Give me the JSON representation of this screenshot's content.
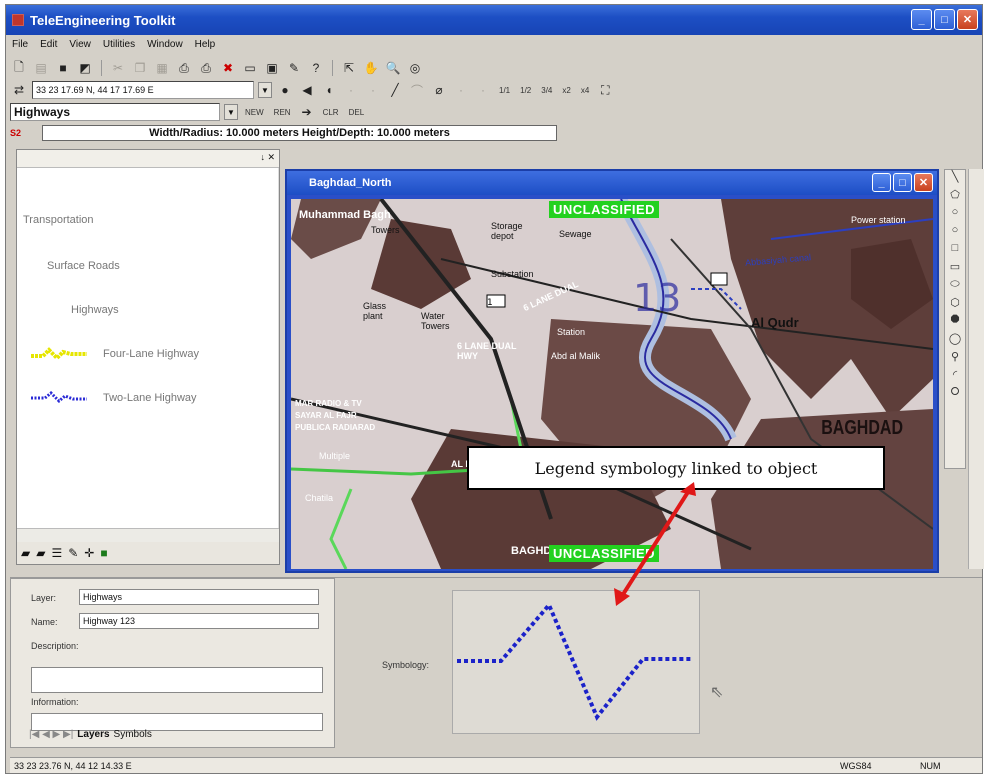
{
  "app": {
    "title": "TeleEngineering Toolkit"
  },
  "menu": [
    "File",
    "Edit",
    "View",
    "Utilities",
    "Window",
    "Help"
  ],
  "toolbar": {
    "coordinate": "33 23 17.69 N, 44 17 17.69 E",
    "scale_buttons": [
      "1/1",
      "1/2",
      "3/4",
      "x2",
      "x4"
    ],
    "layer": "Highways",
    "layer_actions": [
      "NEW",
      "REN",
      "CLR",
      "DEL"
    ],
    "size_label": "S2",
    "size_info": "Width/Radius: 10.000 meters Height/Depth: 10.000 meters"
  },
  "legend_panel": {
    "tree": [
      {
        "label": "Transportation",
        "level": 0
      },
      {
        "label": "Surface Roads",
        "level": 1
      },
      {
        "label": "Highways",
        "level": 2
      },
      {
        "label": "Four-Lane Highway",
        "level": 3,
        "color": "#e6e600"
      },
      {
        "label": "Two-Lane Highway",
        "level": 3,
        "color": "#2a2ad6"
      }
    ]
  },
  "map_window": {
    "title": "Baghdad_North",
    "banner_top": "UNCLASSIFIED",
    "banner_bottom": "UNCLASSIFIED",
    "map_labels": [
      "Muhammad Bagh",
      "Towers",
      "Storage depot",
      "Sewage",
      "Substation",
      "Glass plant",
      "Water Towers",
      "6 LANE DUAL",
      "Station",
      "Abd al Malik",
      "6 LANE DUAL HWY",
      "AL BAB AL",
      "Al Qudr",
      "BAGHDAD",
      "Multiple",
      "Chatila",
      "Power station",
      "Abbasiyah canal",
      "MAR RADIO & TV",
      "SAYAR AL FAJR",
      "PUBLICA RADIARAD",
      "BAGHDAD"
    ],
    "route_number": "1"
  },
  "callout": {
    "text": "Legend symbology linked to object"
  },
  "properties": {
    "layer_label": "Layer:",
    "layer_value": "Highways",
    "name_label": "Name:",
    "name_value": "Highway 123",
    "description_label": "Description:",
    "information_label": "Information:",
    "tabs": [
      "Layers",
      "Symbols"
    ],
    "symbology_label": "Symbology:"
  },
  "status_bar": {
    "coordinate": "33 23 23.76 N, 44 12 14.33 E",
    "datum": "WGS84",
    "num": "NUM"
  },
  "colors": {
    "title_blue": "#1d4fc4",
    "banner_green": "#23d11f",
    "symbol_blue": "#1b22c9",
    "arrow_red": "#e01818"
  }
}
